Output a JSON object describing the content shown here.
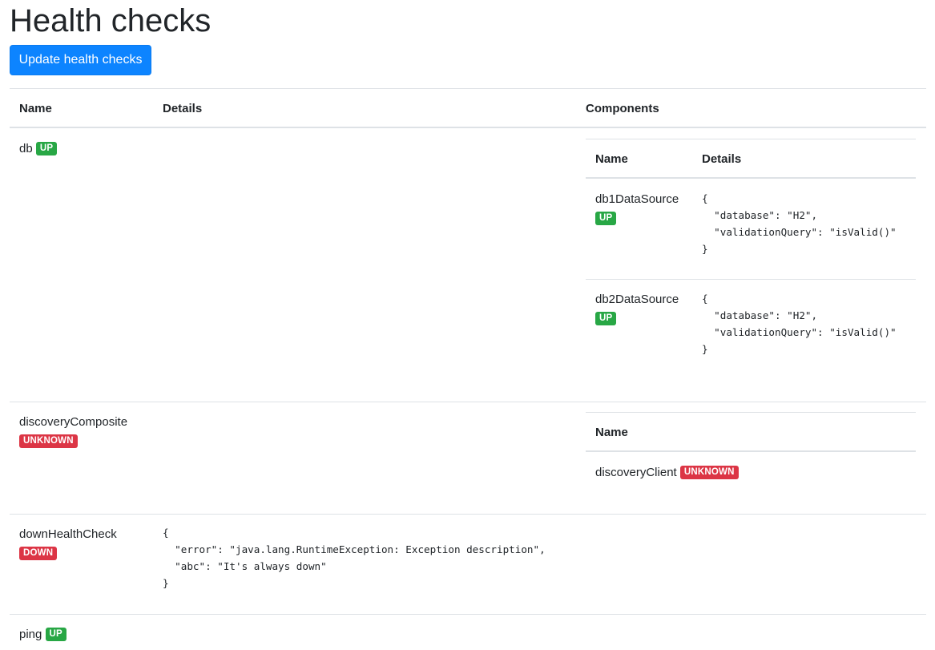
{
  "page": {
    "title": "Health checks"
  },
  "toolbar": {
    "update_label": "Update health checks"
  },
  "colors": {
    "up": "#28a745",
    "unknown": "#dc3545",
    "down": "#dc3545",
    "primary": "#0d84ff"
  },
  "table": {
    "headers": {
      "name": "Name",
      "details": "Details",
      "components": "Components"
    },
    "rows": [
      {
        "name": "db",
        "status": "UP",
        "details": "",
        "components": {
          "headers": {
            "name": "Name",
            "details": "Details"
          },
          "items": [
            {
              "name": "db1DataSource",
              "status": "UP",
              "details": "{\n  \"database\": \"H2\",\n  \"validationQuery\": \"isValid()\"\n}"
            },
            {
              "name": "db2DataSource",
              "status": "UP",
              "details": "{\n  \"database\": \"H2\",\n  \"validationQuery\": \"isValid()\"\n}"
            }
          ]
        }
      },
      {
        "name": "discoveryComposite",
        "status": "UNKNOWN",
        "details": "",
        "components": {
          "headers": {
            "name": "Name"
          },
          "items": [
            {
              "name": "discoveryClient",
              "status": "UNKNOWN"
            }
          ]
        }
      },
      {
        "name": "downHealthCheck",
        "status": "DOWN",
        "details": "{\n  \"error\": \"java.lang.RuntimeException: Exception description\",\n  \"abc\": \"It's always down\"\n}"
      },
      {
        "name": "ping",
        "status": "UP",
        "details": ""
      }
    ]
  }
}
